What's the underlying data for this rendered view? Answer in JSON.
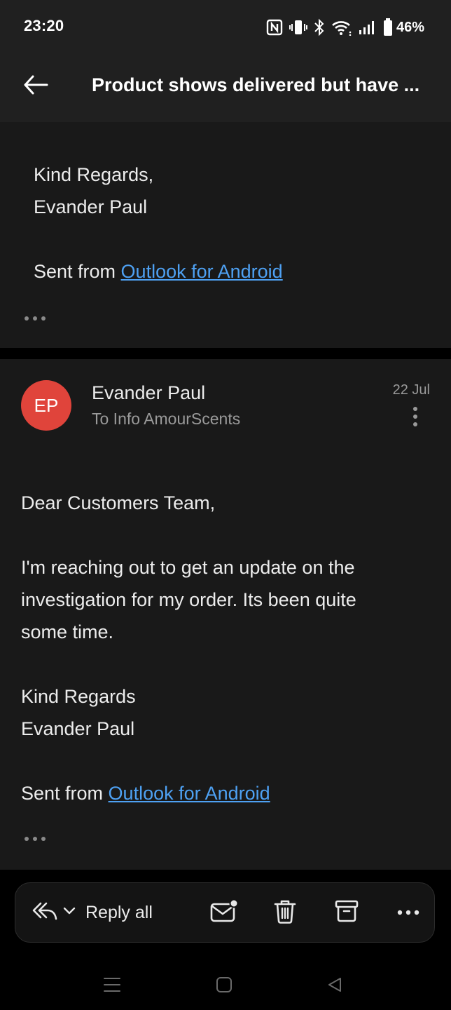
{
  "status_bar": {
    "time": "23:20",
    "battery": "46%",
    "icons": [
      "nfc-icon",
      "vibrate-icon",
      "bluetooth-icon",
      "wifi-icon",
      "signal-icon",
      "battery-icon"
    ]
  },
  "header": {
    "title": "Product shows delivered but have ..."
  },
  "message_1": {
    "closing_line1": "Kind Regards,",
    "closing_line2": "Evander Paul",
    "sent_from_prefix": "Sent from ",
    "sent_from_link": "Outlook for Android"
  },
  "message_2": {
    "avatar_initials": "EP",
    "avatar_color": "#e0443b",
    "sender": "Evander Paul",
    "recipient": "To Info AmourScents",
    "date": "22 Jul",
    "greeting": "Dear Customers Team,",
    "paragraph_lines": [
      "I'm reaching out to get an update on the",
      "investigation for my order. Its been quite",
      "some time."
    ],
    "closing_line1": "Kind Regards",
    "closing_line2": "Evander Paul",
    "sent_from_prefix": "Sent from ",
    "sent_from_link": "Outlook for Android"
  },
  "action_bar": {
    "reply_all_label": "Reply all"
  },
  "colors": {
    "link": "#4ea1f3",
    "surface": "#191919",
    "header": "#202020"
  }
}
